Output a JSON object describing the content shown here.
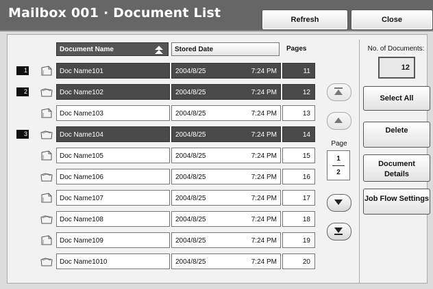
{
  "window": {
    "title": "Mailbox 001 · Document List"
  },
  "header": {
    "refresh_label": "Refresh",
    "close_label": "Close"
  },
  "table": {
    "columns": {
      "name": "Document Name",
      "date": "Stored Date",
      "pages": "Pages"
    },
    "rows": [
      {
        "name": "Doc Name101",
        "date": "2004/8/25",
        "time": "7:24 PM",
        "pages": "11",
        "selected": "1"
      },
      {
        "name": "Doc Name102",
        "date": "2004/8/25",
        "time": "7:24 PM",
        "pages": "12",
        "selected": "2"
      },
      {
        "name": "Doc Name103",
        "date": "2004/8/25",
        "time": "7:24 PM",
        "pages": "13",
        "selected": ""
      },
      {
        "name": "Doc Name104",
        "date": "2004/8/25",
        "time": "7:24 PM",
        "pages": "14",
        "selected": "3"
      },
      {
        "name": "Doc Name105",
        "date": "2004/8/25",
        "time": "7:24 PM",
        "pages": "15",
        "selected": ""
      },
      {
        "name": "Doc Name106",
        "date": "2004/8/25",
        "time": "7:24 PM",
        "pages": "16",
        "selected": ""
      },
      {
        "name": "Doc Name107",
        "date": "2004/8/25",
        "time": "7:24 PM",
        "pages": "17",
        "selected": ""
      },
      {
        "name": "Doc Name108",
        "date": "2004/8/25",
        "time": "7:24 PM",
        "pages": "18",
        "selected": ""
      },
      {
        "name": "Doc Name109",
        "date": "2004/8/25",
        "time": "7:24 PM",
        "pages": "19",
        "selected": ""
      },
      {
        "name": "Doc Name1010",
        "date": "2004/8/25",
        "time": "7:24 PM",
        "pages": "20",
        "selected": ""
      }
    ]
  },
  "pager": {
    "label": "Page",
    "current": "1",
    "total": "2"
  },
  "sidebar": {
    "num_docs_label": "No. of Documents:",
    "num_docs_value": "12",
    "select_all_label": "Select All",
    "delete_label": "Delete",
    "details_line1": "Document",
    "details_line2": "Details",
    "job_flow_label": "Job Flow Settings"
  },
  "icons": {
    "sort": "sort-ascending-icon",
    "doc_open": "open-folder-icon",
    "doc_stack": "document-stack-icon",
    "first": "first-page-icon",
    "prev": "page-up-icon",
    "next": "page-down-icon",
    "last": "last-page-icon"
  },
  "colors": {
    "header_bg": "#666666",
    "selected_row": "#4a4a4a"
  }
}
